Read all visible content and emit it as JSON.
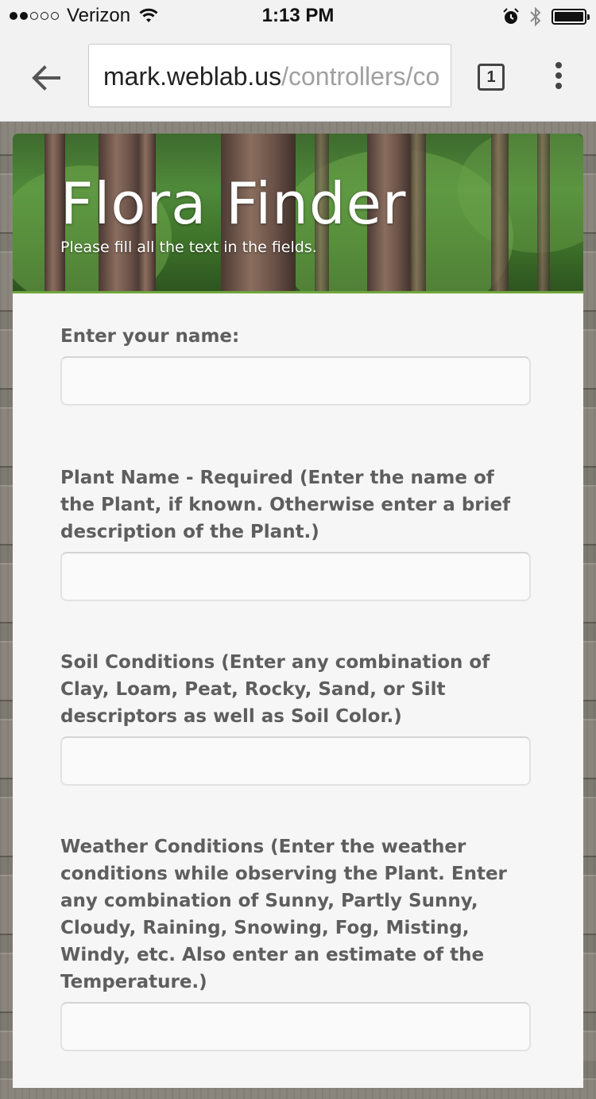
{
  "status_bar": {
    "carrier": "Verizon",
    "time": "1:13 PM",
    "signal_bars_filled": 2,
    "signal_bars_total": 5,
    "battery_level": 1.0
  },
  "browser": {
    "url_host": "mark.weblab.us",
    "url_path": "/controllers/co",
    "tab_count": "1"
  },
  "banner": {
    "title": "Flora Finder",
    "subtitle": "Please fill all the text in the fields."
  },
  "form": {
    "fields": [
      {
        "label": "Enter your name:",
        "value": "",
        "placeholder": ""
      },
      {
        "label": "Plant Name - Required (Enter the name of the Plant, if known. Otherwise enter a brief description of the Plant.)",
        "value": "",
        "placeholder": ""
      },
      {
        "label": "Soil Conditions (Enter any combination of Clay, Loam, Peat, Rocky, Sand, or Silt descriptors as well as Soil Color.)",
        "value": "",
        "placeholder": ""
      },
      {
        "label": "Weather Conditions (Enter the weather conditions while observing the Plant. Enter any combination of Sunny, Partly Sunny, Cloudy, Raining, Snowing, Fog, Misting, Windy, etc. Also enter an estimate of the Temperature.)",
        "value": "",
        "placeholder": ""
      }
    ]
  },
  "icons": {
    "wifi": "wifi-icon",
    "alarm": "alarm-icon",
    "bluetooth": "bluetooth-icon",
    "battery": "battery-icon",
    "back": "back-arrow-icon",
    "tabs": "tab-switcher-icon",
    "menu": "overflow-menu-icon"
  }
}
